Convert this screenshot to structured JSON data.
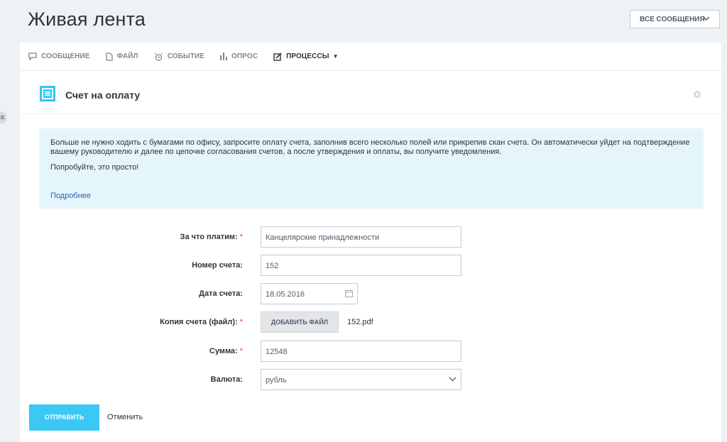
{
  "page": {
    "title": "Живая лента"
  },
  "filter": {
    "label": "ВСЕ СООБЩЕНИЯ"
  },
  "left_tab": {
    "label": "а"
  },
  "tabs": [
    {
      "label": "СООБЩЕНИЕ",
      "icon": "message-icon"
    },
    {
      "label": "ФАЙЛ",
      "icon": "file-icon"
    },
    {
      "label": "СОБЫТИЕ",
      "icon": "alarm-icon"
    },
    {
      "label": "ОПРОС",
      "icon": "poll-icon"
    },
    {
      "label": "ПРОЦЕССЫ",
      "icon": "edit-icon"
    }
  ],
  "form": {
    "title": "Счет на оплату",
    "info": {
      "text1": "Больше не нужно ходить с бумагами по офису, запросите оплату счета, заполнив всего несколько полей или прикрепив скан счета. Он автоматически уйдет на подтверждение вашему руководителю и далее по цепочке согласования счетов, а после утверждения и оплаты, вы получите уведомления.",
      "text2": "Попробуйте, это просто!",
      "more": "Подробнее"
    },
    "fields": {
      "purpose": {
        "label": "За что платим:",
        "required_mark": "*",
        "value": "Канцелярские принадлежности"
      },
      "number": {
        "label": "Номер счета:",
        "value": "152"
      },
      "date": {
        "label": "Дата счета:",
        "value": "18.05.2016"
      },
      "copy": {
        "label": "Копия счета (файл):",
        "required_mark": "*",
        "button": "ДОБАВИТЬ ФАЙЛ",
        "file": "152.pdf"
      },
      "amount": {
        "label": "Сумма:",
        "required_mark": "*",
        "value": "12548"
      },
      "currency": {
        "label": "Валюта:",
        "value": "рубль"
      }
    },
    "send": "ОТПРАВИТЬ",
    "cancel": "Отменить"
  },
  "colors": {
    "accent": "#3bc8f5",
    "info_bg": "#e5f5fc",
    "link": "#2067b0",
    "required": "#f0371b"
  }
}
